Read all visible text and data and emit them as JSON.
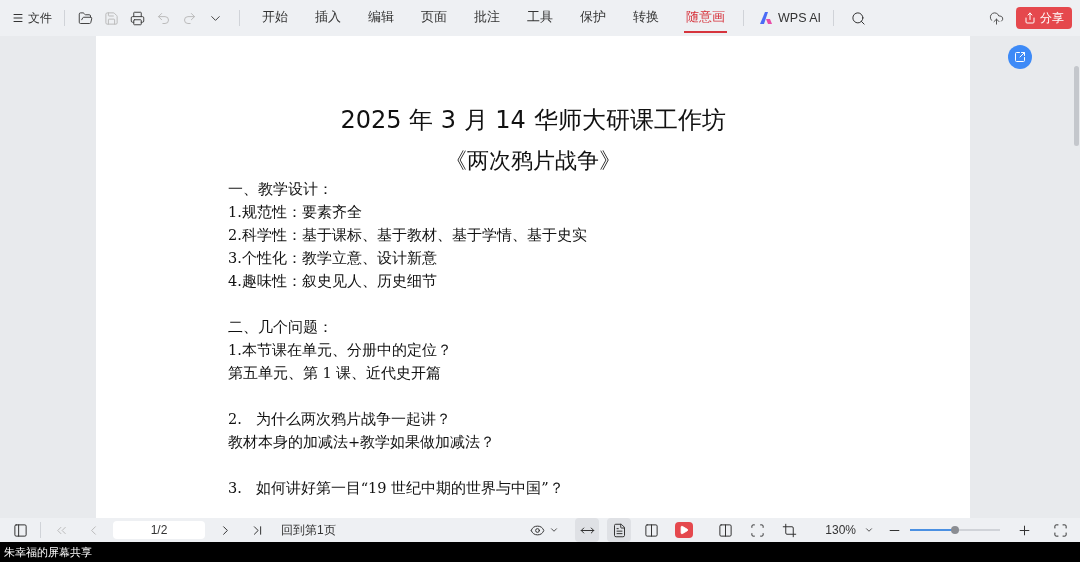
{
  "toolbar": {
    "file_menu": "文件",
    "tabs": [
      {
        "label": "开始",
        "selected": false
      },
      {
        "label": "插入",
        "selected": false
      },
      {
        "label": "编辑",
        "selected": false
      },
      {
        "label": "页面",
        "selected": false
      },
      {
        "label": "批注",
        "selected": false
      },
      {
        "label": "工具",
        "selected": false
      },
      {
        "label": "保护",
        "selected": false
      },
      {
        "label": "转换",
        "selected": false
      },
      {
        "label": "随意画",
        "selected": true
      }
    ],
    "ai_button": "WPS AI",
    "share_button": "分享"
  },
  "document": {
    "title": "2025 年 3 月 14 华师大研课工作坊",
    "subtitle": "《两次鸦片战争》",
    "sections": [
      [
        "一、教学设计：",
        "1.规范性：要素齐全",
        "2.科学性：基于课标、基于教材、基于学情、基于史实",
        "3.个性化：教学立意、设计新意",
        "4.趣味性：叙史见人、历史细节"
      ],
      [
        "二、几个问题：",
        "1.本节课在单元、分册中的定位？",
        "第五单元、第 1 课、近代史开篇"
      ],
      [
        "2.   为什么两次鸦片战争一起讲？",
        "教材本身的加减法+教学如果做加减法？"
      ],
      [
        "3.   如何讲好第一目“19 世纪中期的世界与中国”？"
      ]
    ]
  },
  "status_bar": {
    "page_field": "1/2",
    "back_link": "回到第1页",
    "view_modes": [
      {
        "selected": true
      },
      {
        "selected": true
      },
      {
        "selected": false
      }
    ],
    "zoom": "130%",
    "zoom_slider": {
      "level": 0.5
    }
  },
  "screen_share_label": "朱幸福的屏幕共享"
}
